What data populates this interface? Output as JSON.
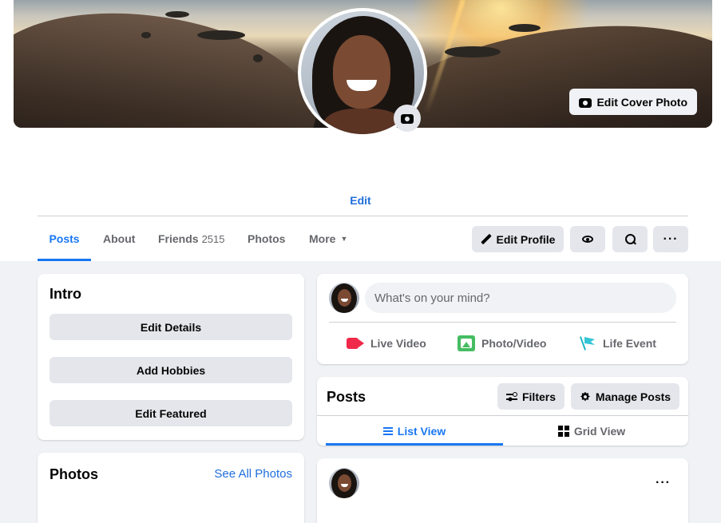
{
  "cover": {
    "edit_label": "Edit Cover Photo"
  },
  "profile": {
    "edit_link": "Edit"
  },
  "nav": {
    "tabs": [
      {
        "label": "Posts",
        "active": true
      },
      {
        "label": "About"
      },
      {
        "label": "Friends",
        "count": "2515"
      },
      {
        "label": "Photos"
      },
      {
        "label": "More"
      }
    ],
    "edit_profile_label": "Edit Profile",
    "more_actions_label": "···"
  },
  "intro": {
    "title": "Intro",
    "buttons": [
      "Edit Details",
      "Add Hobbies",
      "Edit Featured"
    ]
  },
  "photos": {
    "title": "Photos",
    "see_all": "See All Photos"
  },
  "composer": {
    "placeholder": "What's on your mind?",
    "actions": [
      "Live Video",
      "Photo/Video",
      "Life Event"
    ]
  },
  "posts": {
    "title": "Posts",
    "filters_label": "Filters",
    "manage_label": "Manage Posts",
    "views": [
      "List View",
      "Grid View"
    ]
  },
  "post": {
    "menu_label": "···"
  },
  "colors": {
    "accent": "#1877f2",
    "link": "#216fdb",
    "page_bg": "#f0f2f5",
    "button_bg": "#e4e6eb"
  }
}
